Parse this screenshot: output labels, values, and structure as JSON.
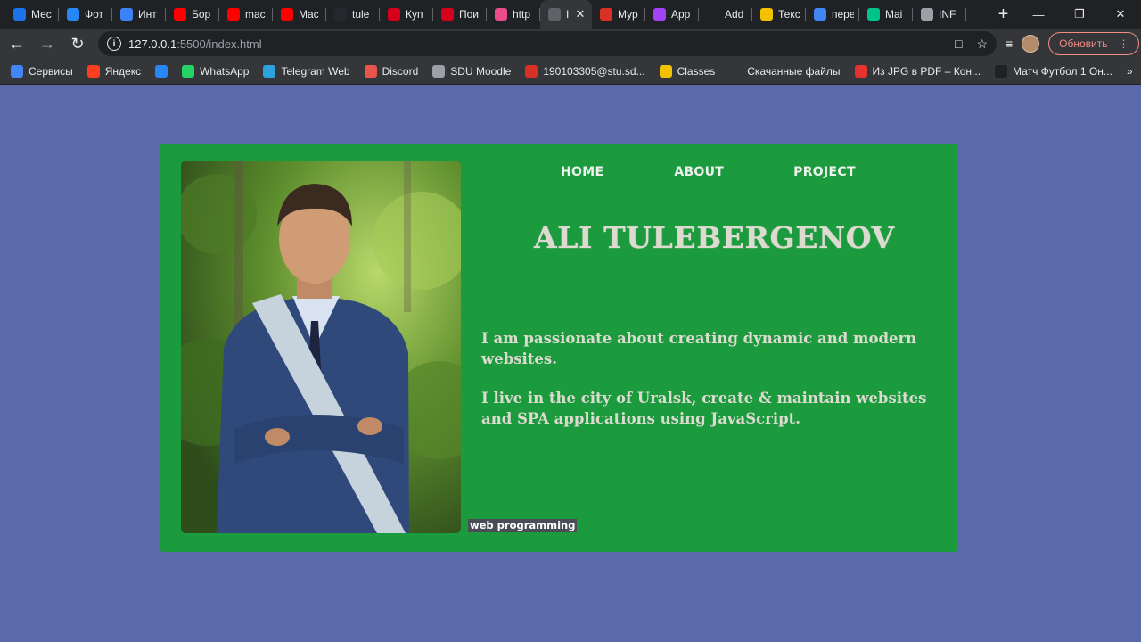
{
  "browser": {
    "tabs": [
      {
        "title": "Мес",
        "icon": "messages-icon",
        "color": "#1a73e8"
      },
      {
        "title": "Фот",
        "icon": "vk-icon",
        "color": "#2787f5"
      },
      {
        "title": "Инт",
        "icon": "pause-icon",
        "color": "#3b82f6"
      },
      {
        "title": "Бор",
        "icon": "youtube-icon",
        "color": "#ff0000"
      },
      {
        "title": "mac",
        "icon": "youtube-icon",
        "color": "#ff0000"
      },
      {
        "title": "Mac",
        "icon": "youtube-icon",
        "color": "#ff0000"
      },
      {
        "title": "tule",
        "icon": "github-icon",
        "color": "#24292e"
      },
      {
        "title": "Куп",
        "icon": "hh-icon",
        "color": "#d6001c"
      },
      {
        "title": "Пои",
        "icon": "hh-icon",
        "color": "#d6001c"
      },
      {
        "title": "http",
        "icon": "dribbble-icon",
        "color": "#ea4c89"
      },
      {
        "title": "I",
        "icon": "globe-icon",
        "color": "#5f6368",
        "active": true
      },
      {
        "title": "Мур",
        "icon": "gmail-icon",
        "color": "#d93025"
      },
      {
        "title": "App",
        "icon": "app-icon",
        "color": "#a142f4"
      },
      {
        "title": "Add",
        "icon": "add-icon",
        "color": "#202124"
      },
      {
        "title": "Текс",
        "icon": "python-icon",
        "color": "#f2c200"
      },
      {
        "title": "пере",
        "icon": "google-icon",
        "color": "#4285f4"
      },
      {
        "title": "Mai",
        "icon": "mail-icon",
        "color": "#00c389"
      },
      {
        "title": "INF",
        "icon": "moodle-icon",
        "color": "#9aa0a6"
      }
    ],
    "url_host": "127.0.0.1",
    "url_path": ":5500/index.html",
    "update_label": "Обновить",
    "bookmarks": [
      {
        "label": "Сервисы",
        "icon": "apps-grid-icon",
        "color": "#4285f4"
      },
      {
        "label": "Яндекс",
        "icon": "yandex-icon",
        "color": "#fc3f1d"
      },
      {
        "label": "",
        "icon": "vk-icon",
        "color": "#2787f5"
      },
      {
        "label": "WhatsApp",
        "icon": "whatsapp-icon",
        "color": "#25d366"
      },
      {
        "label": "Telegram Web",
        "icon": "telegram-icon",
        "color": "#2aa3df"
      },
      {
        "label": "Discord",
        "icon": "discord-icon",
        "color": "#e8554a"
      },
      {
        "label": "SDU Moodle",
        "icon": "moodle-icon",
        "color": "#9aa0a6"
      },
      {
        "label": "190103305@stu.sd...",
        "icon": "gmail-icon",
        "color": "#d93025"
      },
      {
        "label": "Classes",
        "icon": "classroom-icon",
        "color": "#f2c200"
      },
      {
        "label": "Скачанные файлы",
        "icon": "download-icon",
        "color": "#35363a"
      },
      {
        "label": "Из JPG в PDF – Кон...",
        "icon": "pdf-icon",
        "color": "#e5322d"
      },
      {
        "label": "Матч Футбол 1 Он...",
        "icon": "football-icon",
        "color": "#202124"
      }
    ]
  },
  "page": {
    "nav": [
      "HOME",
      "ABOUT",
      "PROJECT"
    ],
    "name": "ALI TULEBERGENOV",
    "bio_1": "I am passionate about creating dynamic and modern websites.",
    "bio_2": "I live in the city of Uralsk, create & maintain websites and SPA applications using JavaScript.",
    "badge": "web programming",
    "colors": {
      "background": "#5b68aa",
      "card": "#1c9a3e",
      "heading": "#dddad0"
    }
  }
}
